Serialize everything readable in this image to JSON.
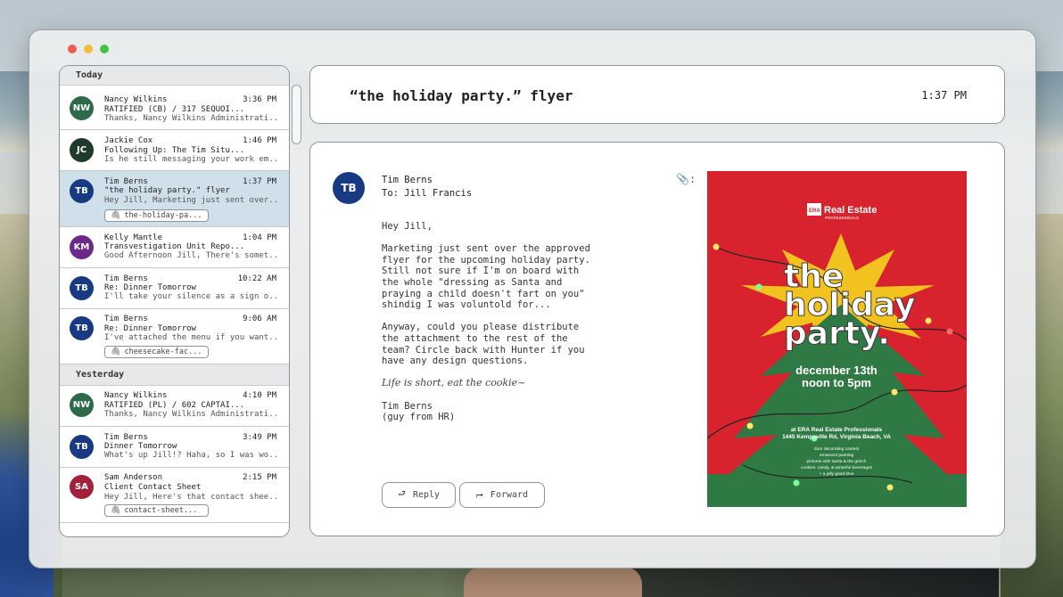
{
  "sidebar": {
    "sections": [
      {
        "label": "Today",
        "items": [
          {
            "initials": "NW",
            "avatar_color": "#2c6a4a",
            "sender": "Nancy Wilkins",
            "time": "3:36 PM",
            "subject": "RATIFIED (CB) / 317 SEQUOI...",
            "preview": "Thanks, Nancy Wilkins Administrati...",
            "attachment": ""
          },
          {
            "initials": "JC",
            "avatar_color": "#1f3a2b",
            "sender": "Jackie Cox",
            "time": "1:46 PM",
            "subject": "Following Up: The Tim Situ...",
            "preview": "Is he still messaging your work em...",
            "attachment": ""
          },
          {
            "initials": "TB",
            "avatar_color": "#173a82",
            "sender": "Tim Berns",
            "time": "1:37 PM",
            "subject": "\"the holiday party.\" flyer",
            "preview": "Hey Jill, Marketing just sent over...",
            "attachment": "the-holiday-pa..."
          },
          {
            "initials": "KM",
            "avatar_color": "#6b2a8a",
            "sender": "Kelly Mantle",
            "time": "1:04 PM",
            "subject": "Transvestigation Unit Repo...",
            "preview": "Good Afternoon Jill, There's somet...",
            "attachment": ""
          },
          {
            "initials": "TB",
            "avatar_color": "#173a82",
            "sender": "Tim Berns",
            "time": "10:22 AM",
            "subject": "Re: Dinner Tomorrow",
            "preview": "I'll take your silence as a sign o...",
            "attachment": ""
          },
          {
            "initials": "TB",
            "avatar_color": "#173a82",
            "sender": "Tim Berns",
            "time": "9:06 AM",
            "subject": "Re: Dinner Tomorrow",
            "preview": "I've attached the menu if you want...",
            "attachment": "cheesecake-fac..."
          }
        ]
      },
      {
        "label": "Yesterday",
        "items": [
          {
            "initials": "NW",
            "avatar_color": "#2c6a4a",
            "sender": "Nancy Wilkins",
            "time": "4:10 PM",
            "subject": "RATIFIED (PL) / 602 CAPTAI...",
            "preview": "Thanks, Nancy Wilkins Administrati...",
            "attachment": ""
          },
          {
            "initials": "TB",
            "avatar_color": "#173a82",
            "sender": "Tim Berns",
            "time": "3:49 PM",
            "subject": "Dinner Tomorrow",
            "preview": "What's up Jill!? Haha, so I was wo...",
            "attachment": ""
          },
          {
            "initials": "SA",
            "avatar_color": "#a3203a",
            "sender": "Sam Anderson",
            "time": "2:15 PM",
            "subject": "Client Contact Sheet",
            "preview": "Hey Jill, Here's that contact shee...",
            "attachment": "contact-sheet..."
          }
        ]
      }
    ]
  },
  "header": {
    "title": "“the holiday party.” flyer",
    "time": "1:37 PM"
  },
  "message": {
    "avatar_initials": "TB",
    "from": "Tim Berns",
    "to": "To: Jill Francis",
    "clip_icon": "paperclip-icon",
    "greeting": "Hey Jill,",
    "paragraph1": "Marketing just sent over the approved\nflyer for the upcoming holiday party.\nStill not sure if I'm on board with\nthe whole \"dressing as Santa and\npraying a child doesn't fart on you\"\nshindig I was voluntold for...",
    "paragraph2": "Anyway, could you please distribute\nthe attachment to the rest of the\nteam? Circle back with Hunter if you\nhave any design questions.",
    "signature_quote": "Life is short, eat the cookie~",
    "signature_name": "Tim Berns",
    "signature_title": "(guy from HR)",
    "reply_label": "Reply",
    "forward_label": "Forward"
  },
  "flyer": {
    "brand": "Real Estate",
    "brand_sub": "PROFESSIONALS",
    "brand_mark": "ERA",
    "title_line1": "the",
    "title_line2": "holiday",
    "title_line3": "party.",
    "date": "december 13th",
    "time": "noon to 5pm",
    "venue": "at ERA Real Estate Professionals",
    "address": "1445 Kempsville Rd, Virginia Beach, VA",
    "activities": [
      "door decorating contest",
      "ornament painting",
      "pictures with santa & the grinch",
      "cookies, candy, & winterful beverages",
      "+ a jolly good time"
    ],
    "colors": {
      "background": "#d8232f",
      "tree": "#2f7a44",
      "star": "#f2c21f"
    }
  }
}
